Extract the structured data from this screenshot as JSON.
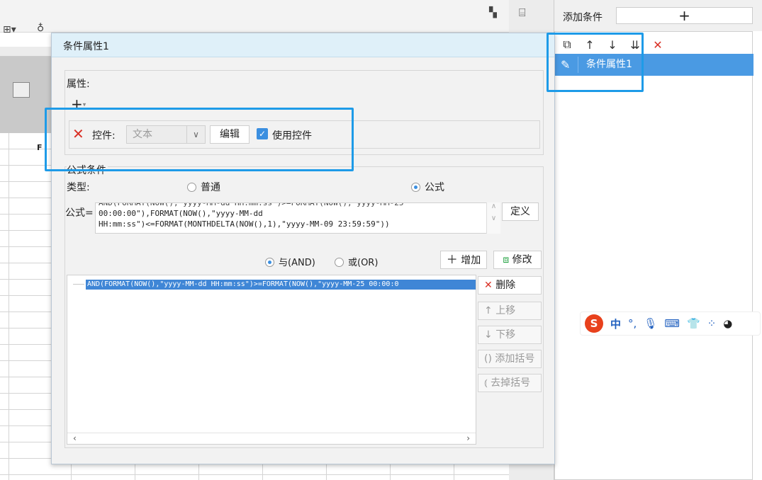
{
  "app": {
    "ruler_col_label": "F"
  },
  "right_panel": {
    "add_condition_label": "添加条件",
    "add_condition_button": "+",
    "tools": [
      {
        "icon": "copy-icon",
        "glyph": "⧉"
      },
      {
        "icon": "arrow-up-icon",
        "glyph": "🡑"
      },
      {
        "icon": "arrow-down-icon",
        "glyph": "🡓"
      },
      {
        "icon": "sort-down-icon",
        "glyph": "⇊"
      },
      {
        "icon": "delete-icon",
        "glyph": "✕"
      }
    ],
    "items": [
      {
        "label": "条件属性1",
        "selected": true
      }
    ]
  },
  "dialog": {
    "title": "条件属性1",
    "attributes": {
      "legend": "属性:",
      "add_button": "+",
      "widget": {
        "label": "控件:",
        "select_value": "文本",
        "edit_button": "编辑",
        "use_widget_checked": true,
        "use_widget_label": "使用控件"
      }
    },
    "formula_condition": {
      "legend": "公式条件",
      "type_label": "类型:",
      "type_options": [
        "普通",
        "公式"
      ],
      "type_selected": "公式",
      "formula_label": "公式=",
      "formula_lines": [
        "AND(FORMAT(NOW(),\"yyyy-MM-dd HH:mm:ss\")>=FORMAT(NOW(),\"yyyy-MM-25",
        "00:00:00\"),FORMAT(NOW(),\"yyyy-MM-dd",
        "HH:mm:ss\")<=FORMAT(MONTHDELTA(NOW(),1),\"yyyy-MM-09 23:59:59\"))"
      ],
      "define_button": "定义",
      "logic_and": "与(AND)",
      "logic_or": "或(OR)",
      "logic_selected": "与(AND)",
      "add_button": "增加",
      "modify_button": "修改",
      "conditions": [
        "AND(FORMAT(NOW(),\"yyyy-MM-dd HH:mm:ss\")>=FORMAT(NOW(),\"yyyy-MM-25 00:00:0"
      ],
      "side_buttons": {
        "delete": "删除",
        "move_up": "上移",
        "move_down": "下移",
        "add_bracket": "添加括号",
        "remove_bracket": "去掉括号"
      }
    }
  },
  "ime": {
    "logo": "S",
    "mode": "中",
    "punct": "°,",
    "icons": [
      "mic-icon",
      "keyboard-icon",
      "shirt-icon",
      "grid-icon",
      "avatar-icon"
    ]
  },
  "colors": {
    "accent": "#1e9be8",
    "selection": "#4a9ae3",
    "delete_red": "#d93025",
    "dialog_title_bg": "#dff0f9"
  }
}
